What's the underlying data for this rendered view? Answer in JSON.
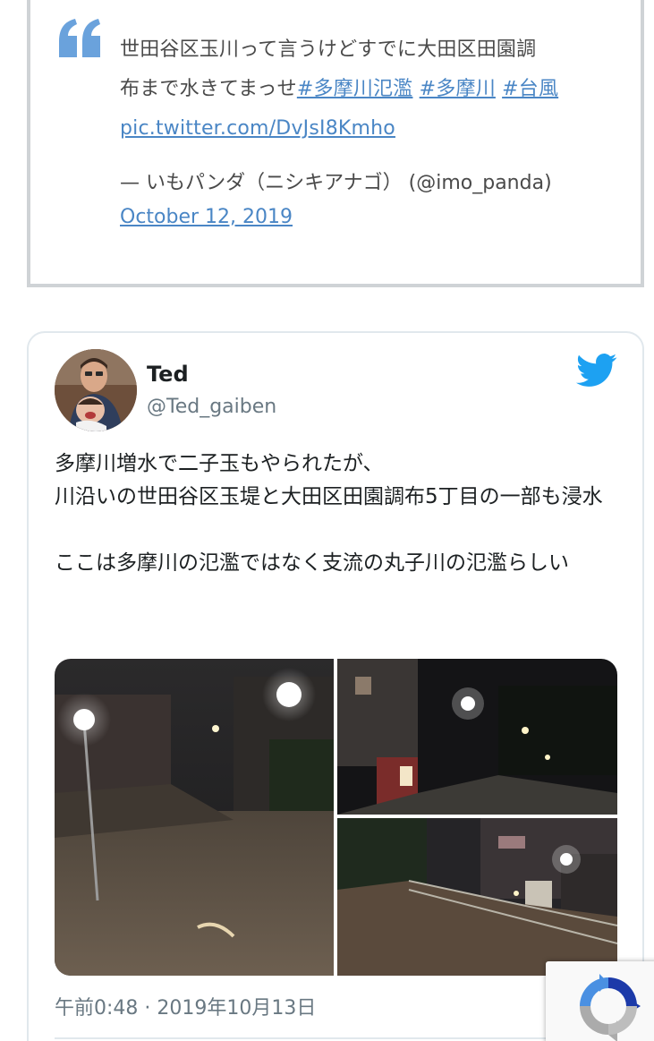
{
  "quote": {
    "text_line1": "世田谷区玉川って言うけどすでに大田区田園調",
    "text_line2_prefix": "布まで水きてまっせ",
    "hashtags": [
      "#多摩川氾濫",
      "#多摩川",
      "#台風"
    ],
    "pic_link": "pic.twitter.com/DvJsI8Kmho",
    "author": "— いもパンダ（ニシキアナゴ） (@imo_panda)",
    "date": "October 12, 2019"
  },
  "tweet": {
    "display_name": "Ted",
    "handle": "@Ted_gaiben",
    "text": "多摩川増水で二子玉もやられたが、\n川沿いの世田谷区玉堤と大田区田園調布5丁目の一部も浸水\n\nここは多摩川の氾濫ではなく支流の丸子川の氾濫らしい",
    "timestamp": "午前0:48 · 2019年10月13日",
    "media_count": 3
  },
  "icons": {
    "quote": "quote-mark-icon",
    "twitter": "twitter-bird-icon",
    "recaptcha": "recaptcha-icon"
  },
  "colors": {
    "link": "#4a86c5",
    "twitter_blue": "#1da1f2",
    "quote_mark": "#6aa2dc",
    "muted": "#697882"
  }
}
